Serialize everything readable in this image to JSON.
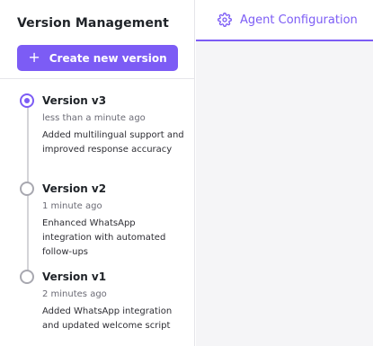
{
  "colors": {
    "accent": "#7c5cf5",
    "button_bg": "#7c5cf5"
  },
  "sidebar": {
    "title": "Version Management",
    "create_button": {
      "icon": "plus-icon",
      "label": "Create new version"
    },
    "versions": [
      {
        "name": "Version v3",
        "time": "less than a minute ago",
        "description": "Added multilingual support and improved response accuracy",
        "selected": true
      },
      {
        "name": "Version v2",
        "time": "1 minute ago",
        "description": "Enhanced WhatsApp integration with automated follow-ups",
        "selected": false
      },
      {
        "name": "Version v1",
        "time": "2 minutes ago",
        "description": "Added WhatsApp integration and updated welcome script",
        "selected": false
      }
    ]
  },
  "main": {
    "tabs": [
      {
        "icon": "gear-icon",
        "label": "Agent Configuration",
        "active": true
      }
    ]
  }
}
